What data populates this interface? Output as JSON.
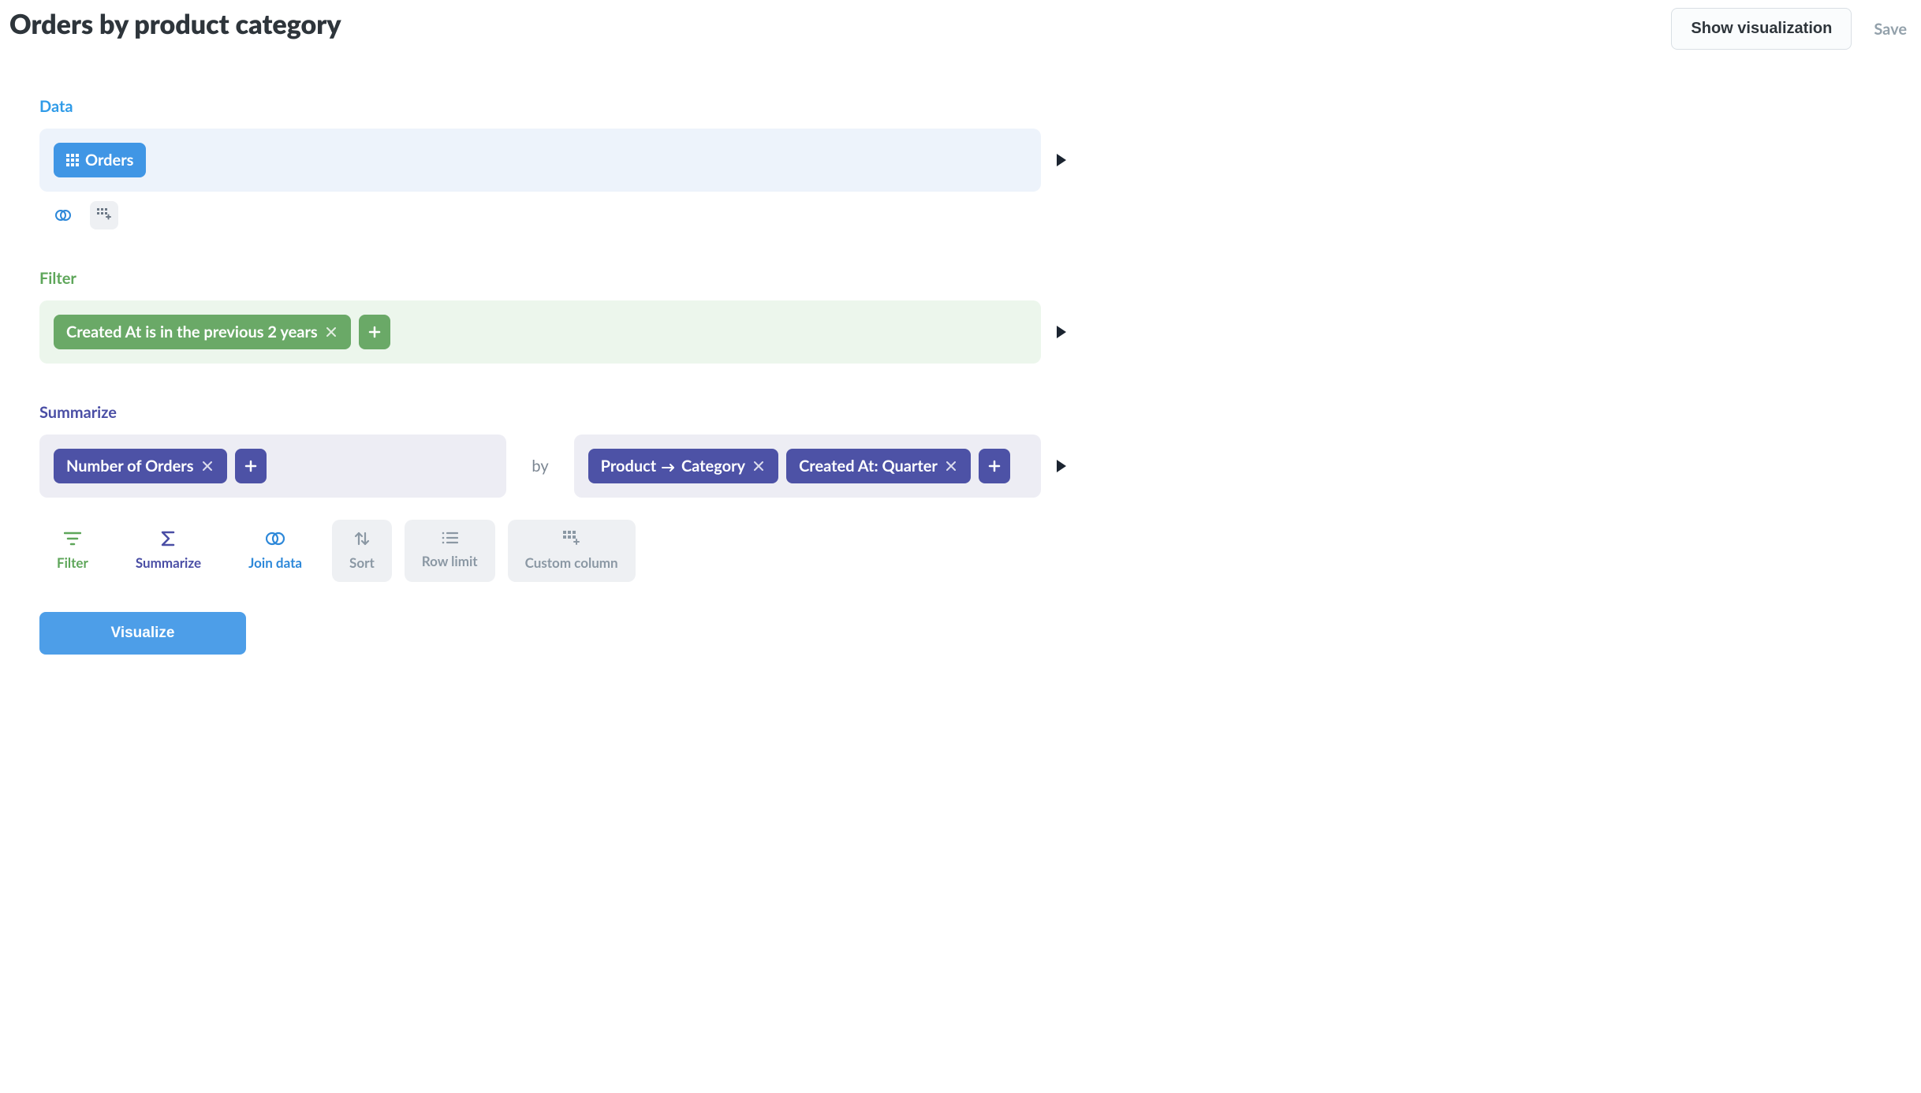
{
  "header": {
    "title": "Orders by product category",
    "show_visualization": "Show visualization",
    "save": "Save"
  },
  "sections": {
    "data": {
      "label": "Data",
      "table": "Orders"
    },
    "filter": {
      "label": "Filter",
      "items": [
        "Created At is in the previous 2 years"
      ]
    },
    "summarize": {
      "label": "Summarize",
      "metrics": [
        "Number of Orders"
      ],
      "by_label": "by",
      "groups": [
        "Product → Category",
        "Created At: Quarter"
      ]
    }
  },
  "toolbar": {
    "filter": "Filter",
    "summarize": "Summarize",
    "join": "Join data",
    "sort": "Sort",
    "row_limit": "Row limit",
    "custom_col": "Custom column"
  },
  "visualize": "Visualize"
}
